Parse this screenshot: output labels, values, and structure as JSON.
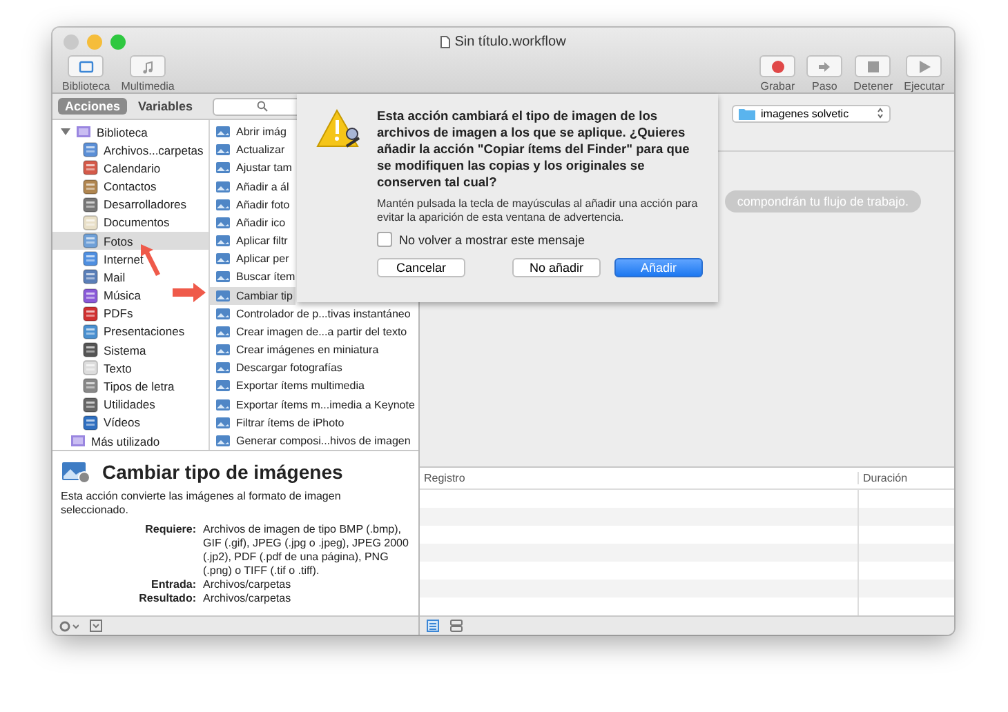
{
  "window": {
    "title": "Sin título.workflow"
  },
  "toolbar": {
    "left": [
      {
        "label": "Biblioteca",
        "kind": "library"
      },
      {
        "label": "Multimedia",
        "kind": "media"
      }
    ],
    "right": [
      {
        "label": "Grabar",
        "kind": "record"
      },
      {
        "label": "Paso",
        "kind": "step"
      },
      {
        "label": "Detener",
        "kind": "stop"
      },
      {
        "label": "Ejecutar",
        "kind": "run"
      }
    ]
  },
  "tabs": [
    {
      "label": "Acciones",
      "selected": true
    },
    {
      "label": "Variables",
      "selected": false
    }
  ],
  "library": {
    "items": [
      {
        "label": "Biblioteca",
        "expanded": true,
        "children": [
          {
            "label": "Archivos...carpetas",
            "selected": false
          },
          {
            "label": "Calendario",
            "selected": false
          },
          {
            "label": "Contactos",
            "selected": false
          },
          {
            "label": "Desarrolladores",
            "selected": false
          },
          {
            "label": "Documentos",
            "selected": false
          },
          {
            "label": "Fotos",
            "selected": true
          },
          {
            "label": "Internet",
            "selected": false
          },
          {
            "label": "Mail",
            "selected": false
          },
          {
            "label": "Música",
            "selected": false
          },
          {
            "label": "PDFs",
            "selected": false
          },
          {
            "label": "Presentaciones",
            "selected": false
          },
          {
            "label": "Sistema",
            "selected": false
          },
          {
            "label": "Texto",
            "selected": false
          },
          {
            "label": "Tipos de letra",
            "selected": false
          },
          {
            "label": "Utilidades",
            "selected": false
          },
          {
            "label": "Vídeos",
            "selected": false
          }
        ]
      },
      {
        "label": "Más utilizado"
      }
    ]
  },
  "actions": [
    {
      "label": "Abrir imág",
      "selected": false
    },
    {
      "label": "Actualizar",
      "selected": false
    },
    {
      "label": "Ajustar tam",
      "selected": false
    },
    {
      "label": "Añadir a ál",
      "selected": false
    },
    {
      "label": "Añadir foto",
      "selected": false
    },
    {
      "label": "Añadir ico",
      "selected": false
    },
    {
      "label": "Aplicar filtr",
      "selected": false
    },
    {
      "label": "Aplicar per",
      "selected": false
    },
    {
      "label": "Buscar ítem",
      "selected": false
    },
    {
      "label": "Cambiar tip",
      "selected": true
    },
    {
      "label": "Controlador de p...tivas instantáneo",
      "selected": false
    },
    {
      "label": "Crear imagen de...a partir del texto",
      "selected": false
    },
    {
      "label": "Crear imágenes en miniatura",
      "selected": false
    },
    {
      "label": "Descargar fotografías",
      "selected": false
    },
    {
      "label": "Exportar ítems multimedia",
      "selected": false
    },
    {
      "label": "Exportar ítems m...imedia a Keynote",
      "selected": false
    },
    {
      "label": "Filtrar ítems de iPhoto",
      "selected": false
    },
    {
      "label": "Generar composi...hivos de imagen",
      "selected": false
    }
  ],
  "description": {
    "title": "Cambiar tipo de imágenes",
    "text": "Esta acción convierte las imágenes al formato de imagen seleccionado.",
    "fields": [
      {
        "label": "Requiere:",
        "value": "Archivos de imagen de tipo BMP (.bmp), GIF (.gif), JPEG (.jpg o .jpeg), JPEG 2000 (.jp2), PDF (.pdf de una página), PNG (.png) o TIFF (.tif o .tiff)."
      },
      {
        "label": "Entrada:",
        "value": "Archivos/carpetas"
      },
      {
        "label": "Resultado:",
        "value": "Archivos/carpetas"
      }
    ]
  },
  "workflow": {
    "folder": "imagenes solvetic",
    "hint": "compondrán tu flujo de trabajo."
  },
  "log": {
    "columns": [
      "Registro",
      "Duración"
    ]
  },
  "dialog": {
    "message": "Esta acción cambiará el tipo de imagen de los archivos de imagen a los que se aplique. ¿Quieres añadir la acción \"Copiar ítems del Finder\" para que se modifiquen las copias y los originales se conserven tal cual?",
    "note": "Mantén pulsada la tecla de mayúsculas al añadir una acción para evitar la aparición de esta ventana de advertencia.",
    "checkbox": {
      "label": "No volver a mostrar este mensaje",
      "checked": false
    },
    "buttons": [
      {
        "label": "Cancelar",
        "kind": "normal"
      },
      {
        "label": "No añadir",
        "kind": "normal"
      },
      {
        "label": "Añadir",
        "kind": "default"
      }
    ]
  }
}
